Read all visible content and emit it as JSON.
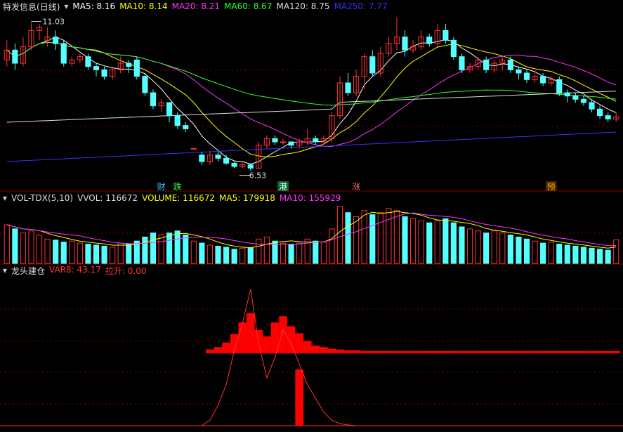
{
  "stock": {
    "name": "特发信息",
    "period": "(日线)"
  },
  "price_panel": {
    "ma_labels": [
      {
        "label": "MA5: 8.16",
        "color": "#ffffff"
      },
      {
        "label": "MA10: 8.14",
        "color": "#ffff00"
      },
      {
        "label": "MA20: 8.21",
        "color": "#ff33ff"
      },
      {
        "label": "MA60: 8.67",
        "color": "#33ff33"
      },
      {
        "label": "MA120: 8.75",
        "color": "#dddddd"
      },
      {
        "label": "MA250: 7.77",
        "color": "#3333ff"
      }
    ],
    "high_label": "11.03",
    "low_label": "6.53",
    "markers": [
      {
        "text": "财",
        "index": 19,
        "fg": "#33ccff",
        "bg": "#000000"
      },
      {
        "text": "跌",
        "index": 21,
        "fg": "#33ff33",
        "bg": "#000000"
      },
      {
        "text": "港",
        "index": 34,
        "fg": "#ffffff",
        "bg": "#006633"
      },
      {
        "text": "涨",
        "index": 43,
        "fg": "#ff6666",
        "bg": "#000000"
      },
      {
        "text": "预",
        "index": 67,
        "fg": "#ffaa00",
        "bg": "#442200"
      }
    ]
  },
  "volume_panel": {
    "labels": [
      {
        "label": "VOL-TDX(5,10)",
        "color": "#dddddd"
      },
      {
        "label": "VVOL: 116672",
        "color": "#dddddd"
      },
      {
        "label": "VOLUME: 116672",
        "color": "#ffff00"
      },
      {
        "label": "MA5: 179918",
        "color": "#ffff00"
      },
      {
        "label": "MA10: 155929",
        "color": "#ff33ff"
      }
    ]
  },
  "indicator_panel": {
    "labels": [
      {
        "label": "龙头建仓",
        "color": "#dddddd"
      },
      {
        "label": "VAR8: 43.17",
        "color": "#ff3333"
      },
      {
        "label": "拉升: 0.00",
        "color": "#ff3333"
      }
    ]
  },
  "colors": {
    "up": "#ff3333",
    "down": "#55ffff",
    "grid": "#880000",
    "bg": "#000000"
  },
  "chart_data": {
    "type": "candlestick",
    "y_range": [
      6.2,
      11.3
    ],
    "candles": [
      [
        9.9,
        10.2,
        9.7,
        10.5
      ],
      [
        10.2,
        9.8,
        9.6,
        10.4
      ],
      [
        9.8,
        10.3,
        9.7,
        10.6
      ],
      [
        10.3,
        10.8,
        10.2,
        11.03
      ],
      [
        10.8,
        10.9,
        10.5,
        11.0
      ],
      [
        10.5,
        10.6,
        10.3,
        10.9
      ],
      [
        10.6,
        10.4,
        10.2,
        10.8
      ],
      [
        10.4,
        9.8,
        9.7,
        10.5
      ],
      [
        9.8,
        9.9,
        9.7,
        10.0
      ],
      [
        9.9,
        10.0,
        9.8,
        10.1
      ],
      [
        10.0,
        9.7,
        9.6,
        10.1
      ],
      [
        9.7,
        9.6,
        9.4,
        9.8
      ],
      [
        9.6,
        9.4,
        9.3,
        9.7
      ],
      [
        9.4,
        9.6,
        9.3,
        9.7
      ],
      [
        9.6,
        9.8,
        9.5,
        10.0
      ],
      [
        9.8,
        9.7,
        9.5,
        9.9
      ],
      [
        9.9,
        9.4,
        9.3,
        10.0
      ],
      [
        9.4,
        8.9,
        8.8,
        9.5
      ],
      [
        8.9,
        8.5,
        8.4,
        9.0
      ],
      [
        8.5,
        8.6,
        8.3,
        8.7
      ],
      [
        8.6,
        8.2,
        8.0,
        8.6
      ],
      [
        8.2,
        7.9,
        7.8,
        8.3
      ],
      [
        7.9,
        7.8,
        7.7,
        8.0
      ],
      [
        7.2,
        7.2,
        7.2,
        7.2
      ],
      [
        7.0,
        6.8,
        6.7,
        7.1
      ],
      [
        6.8,
        7.0,
        6.7,
        7.1
      ],
      [
        7.0,
        6.9,
        6.8,
        7.1
      ],
      [
        6.9,
        6.75,
        6.7,
        7.0
      ],
      [
        6.75,
        6.65,
        6.6,
        6.8
      ],
      [
        6.65,
        6.7,
        6.6,
        6.8
      ],
      [
        6.7,
        6.6,
        6.53,
        6.75
      ],
      [
        6.6,
        7.3,
        6.6,
        7.4
      ],
      [
        7.3,
        7.5,
        7.2,
        7.6
      ],
      [
        7.5,
        7.4,
        7.3,
        7.6
      ],
      [
        7.4,
        7.4,
        7.3,
        7.5
      ],
      [
        7.4,
        7.3,
        7.2,
        7.4
      ],
      [
        7.3,
        7.4,
        7.2,
        7.5
      ],
      [
        7.4,
        7.5,
        7.3,
        7.8
      ],
      [
        7.5,
        7.4,
        7.3,
        7.6
      ],
      [
        7.4,
        7.5,
        7.3,
        7.6
      ],
      [
        7.5,
        8.2,
        7.4,
        8.3
      ],
      [
        8.2,
        9.2,
        8.1,
        9.4
      ],
      [
        9.2,
        8.9,
        8.8,
        9.5
      ],
      [
        8.9,
        9.4,
        8.8,
        9.6
      ],
      [
        9.4,
        10.0,
        9.0,
        10.1
      ],
      [
        10.0,
        9.5,
        9.4,
        10.2
      ],
      [
        9.5,
        10.1,
        9.4,
        10.3
      ],
      [
        10.1,
        10.4,
        10.0,
        10.6
      ],
      [
        10.4,
        10.6,
        10.2,
        11.2
      ],
      [
        10.6,
        10.2,
        10.0,
        10.8
      ],
      [
        10.2,
        10.3,
        10.1,
        10.5
      ],
      [
        10.3,
        10.6,
        10.2,
        10.8
      ],
      [
        10.6,
        10.4,
        10.3,
        10.7
      ],
      [
        10.4,
        10.8,
        10.3,
        11.0
      ],
      [
        10.8,
        10.5,
        10.4,
        11.0
      ],
      [
        10.5,
        10.0,
        9.9,
        10.6
      ],
      [
        10.0,
        9.6,
        9.5,
        10.1
      ],
      [
        9.6,
        9.7,
        9.5,
        9.8
      ],
      [
        9.7,
        9.9,
        9.6,
        10.0
      ],
      [
        9.9,
        9.6,
        9.5,
        10.0
      ],
      [
        9.6,
        9.8,
        9.5,
        9.9
      ],
      [
        9.8,
        9.9,
        9.6,
        10.0
      ],
      [
        9.9,
        9.6,
        9.5,
        10.0
      ],
      [
        9.6,
        9.5,
        9.3,
        9.7
      ],
      [
        9.5,
        9.3,
        9.2,
        9.6
      ],
      [
        9.3,
        9.4,
        9.2,
        9.5
      ],
      [
        9.4,
        9.2,
        9.1,
        9.5
      ],
      [
        9.2,
        9.3,
        9.1,
        9.4
      ],
      [
        9.3,
        8.9,
        8.8,
        9.4
      ],
      [
        8.9,
        8.8,
        8.6,
        9.0
      ],
      [
        8.8,
        8.7,
        8.6,
        8.9
      ],
      [
        8.7,
        8.6,
        8.5,
        8.8
      ],
      [
        8.6,
        8.4,
        8.3,
        8.7
      ],
      [
        8.4,
        8.2,
        8.1,
        8.5
      ],
      [
        8.2,
        8.1,
        8.0,
        8.3
      ],
      [
        8.1,
        8.16,
        8.0,
        8.3
      ]
    ],
    "volume": [
      190,
      170,
      150,
      160,
      140,
      120,
      115,
      105,
      110,
      100,
      95,
      90,
      85,
      80,
      100,
      95,
      110,
      130,
      150,
      140,
      150,
      160,
      140,
      110,
      100,
      90,
      85,
      80,
      70,
      75,
      78,
      120,
      130,
      110,
      100,
      95,
      100,
      120,
      110,
      105,
      170,
      280,
      250,
      230,
      260,
      240,
      250,
      270,
      260,
      230,
      220,
      210,
      200,
      210,
      220,
      200,
      180,
      170,
      160,
      150,
      160,
      150,
      140,
      130,
      120,
      110,
      100,
      105,
      95,
      90,
      85,
      80,
      75,
      70,
      65,
      116
    ],
    "indicator_bars": [
      0,
      0,
      0,
      0,
      0,
      0,
      0,
      0,
      0,
      0,
      0,
      0,
      0,
      0,
      0,
      0,
      0,
      0,
      0,
      0,
      0,
      0,
      0,
      0,
      0,
      5,
      8,
      14,
      25,
      40,
      52,
      30,
      22,
      40,
      48,
      35,
      26,
      16,
      10,
      8,
      6,
      5,
      4,
      4,
      3,
      3,
      3,
      3,
      3,
      3,
      3,
      3,
      3,
      3,
      3,
      3,
      3,
      3,
      3,
      3,
      3,
      3,
      3,
      3,
      3,
      3,
      3,
      3,
      3,
      3,
      3,
      3,
      3,
      3,
      3,
      3
    ],
    "indicator_line": [
      0,
      0,
      0,
      0,
      0,
      0,
      0,
      0,
      0,
      0,
      0,
      0,
      0,
      0,
      0,
      0,
      0,
      0,
      0,
      0,
      0,
      0,
      0,
      0,
      0,
      8,
      30,
      60,
      110,
      150,
      200,
      120,
      70,
      100,
      140,
      120,
      90,
      60,
      40,
      20,
      8,
      3,
      1,
      0,
      0,
      0,
      0,
      0,
      0,
      0,
      0,
      0,
      0,
      0,
      0,
      0,
      0,
      0,
      0,
      0,
      0,
      0,
      0,
      0,
      0,
      0,
      0,
      0,
      0,
      0,
      0,
      0,
      0,
      0,
      0,
      0
    ],
    "lift_bar": {
      "index": 36,
      "value": 80
    }
  }
}
